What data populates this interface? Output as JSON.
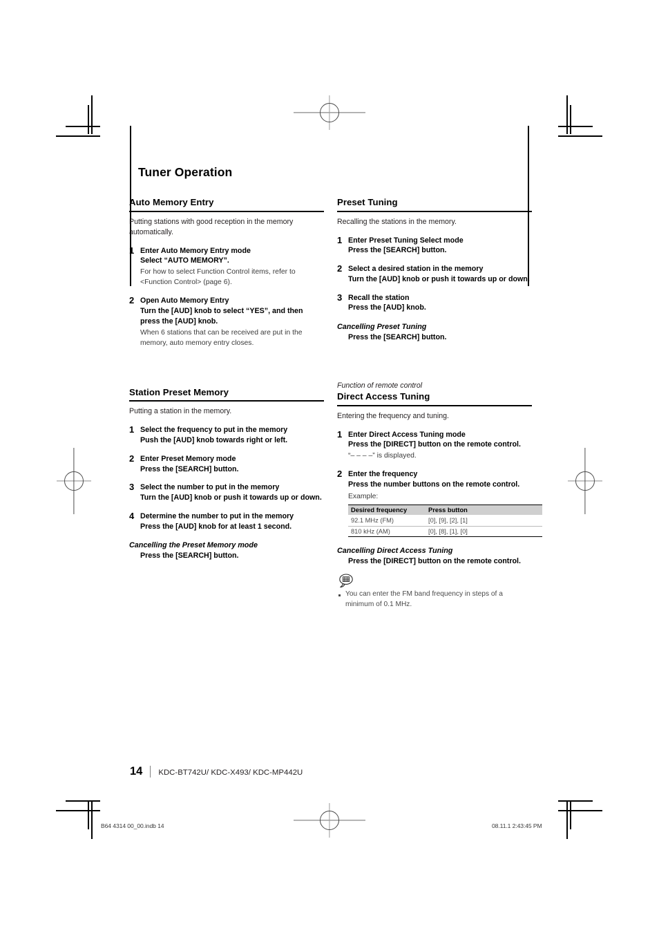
{
  "document": {
    "chapter_title": "Tuner Operation",
    "page_number": "14",
    "models": "KDC-BT742U/ KDC-X493/ KDC-MP442U",
    "print_mark_left": "B64 4314 00_00.indb   14",
    "print_mark_right": "08.11.1   2:43:45 PM"
  },
  "left_column": {
    "sections": [
      {
        "heading": "Auto Memory Entry",
        "intro": "Putting stations with good reception in the memory automatically.",
        "steps": [
          {
            "num": "1",
            "title": "Enter Auto Memory Entry mode",
            "action": "Select “AUTO MEMORY”.",
            "note": "For how to select Function Control items, refer to <Function Control> (page 6)."
          },
          {
            "num": "2",
            "title": "Open Auto Memory Entry",
            "action": "Turn the [AUD] knob to select “YES”, and then press the [AUD] knob.",
            "note": "When 6 stations that can be received are put in the memory, auto memory entry closes."
          }
        ]
      },
      {
        "heading": "Station Preset Memory",
        "intro": "Putting a station in the memory.",
        "steps": [
          {
            "num": "1",
            "title": "Select the frequency to put in the memory",
            "action": "Push the [AUD] knob towards right or left.",
            "note": ""
          },
          {
            "num": "2",
            "title": "Enter Preset Memory mode",
            "action": "Press the [SEARCH] button.",
            "note": ""
          },
          {
            "num": "3",
            "title": "Select the number to put in the memory",
            "action": "Turn the [AUD] knob or push it towards up or down.",
            "note": ""
          },
          {
            "num": "4",
            "title": "Determine the number to put in the memory",
            "action": "Press the [AUD] knob for at least 1 second.",
            "note": ""
          }
        ],
        "cancel": {
          "heading": "Cancelling the Preset Memory mode",
          "body": "Press the [SEARCH] button."
        }
      }
    ]
  },
  "right_column": {
    "sections": [
      {
        "heading": "Preset Tuning",
        "intro": "Recalling the stations in the memory.",
        "steps": [
          {
            "num": "1",
            "title": "Enter Preset Tuning Select mode",
            "action": "Press the [SEARCH] button.",
            "note": ""
          },
          {
            "num": "2",
            "title": "Select a desired station in the memory",
            "action": "Turn the [AUD] knob or push it towards up or down.",
            "note": ""
          },
          {
            "num": "3",
            "title": "Recall the station",
            "action": "Press the [AUD] knob.",
            "note": ""
          }
        ],
        "cancel": {
          "heading": "Cancelling Preset Tuning",
          "body": "Press the [SEARCH] button."
        }
      },
      {
        "kicker": "Function of remote control",
        "heading": "Direct Access Tuning",
        "intro": "Entering the frequency and tuning.",
        "steps": [
          {
            "num": "1",
            "title": "Enter Direct Access Tuning mode",
            "action": "Press the [DIRECT] button on the remote control.",
            "note": "“– – – –” is displayed."
          },
          {
            "num": "2",
            "title": "Enter the frequency",
            "action": "Press the number buttons on the remote control.",
            "note": "Example:"
          }
        ],
        "table": {
          "headers": [
            "Desired frequency",
            "Press button"
          ],
          "rows": [
            [
              "92.1 MHz (FM)",
              "[0], [9], [2], [1]"
            ],
            [
              "810 kHz (AM)",
              "[0], [8], [1], [0]"
            ]
          ]
        },
        "cancel": {
          "heading": "Cancelling Direct Access Tuning",
          "body": "Press the [DIRECT] button on the remote control."
        },
        "notes": [
          "You can enter the FM band frequency in steps of a minimum of 0.1 MHz."
        ]
      }
    ]
  }
}
